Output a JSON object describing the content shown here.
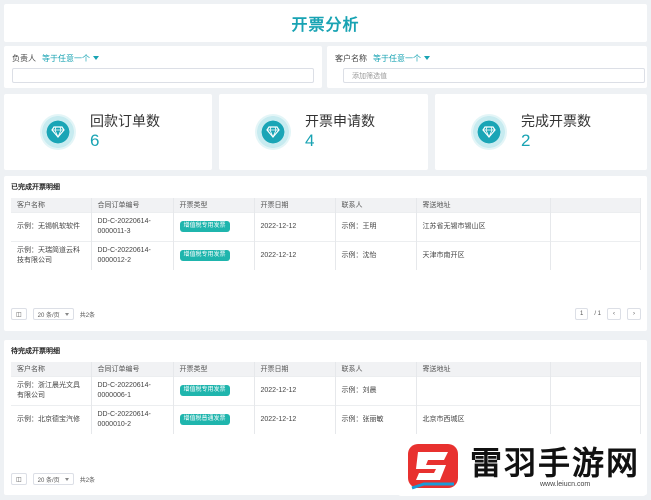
{
  "page": {
    "title": "开票分析"
  },
  "filters": [
    {
      "label": "负责人",
      "op": "等于任意一个",
      "placeholder": ""
    },
    {
      "label": "客户名称",
      "op": "等于任意一个",
      "placeholder": "添加筛选值"
    }
  ],
  "kpis": [
    {
      "label": "回款订单数",
      "value": "6",
      "icon": "diamond-icon"
    },
    {
      "label": "开票申请数",
      "value": "4",
      "icon": "diamond-icon"
    },
    {
      "label": "完成开票数",
      "value": "2",
      "icon": "diamond-icon"
    }
  ],
  "completed": {
    "title": "已完成开票明细",
    "columns": [
      "客户名称",
      "合同订单编号",
      "开票类型",
      "开票日期",
      "联系人",
      "寄送地址"
    ],
    "rows": [
      {
        "customer": "示例：无锡帆软软件",
        "order": "DD-C-20220614-0000011-3",
        "type": "增值税专用发票",
        "date": "2022-12-12",
        "contact": "示例：王明",
        "address": "江苏省无锡市锡山区"
      },
      {
        "customer": "示例：天瑞简道云科技有限公司",
        "order": "DD-C-20220614-0000012-2",
        "type": "增值税专用发票",
        "date": "2022-12-12",
        "contact": "示例：沈怡",
        "address": "天津市南开区"
      }
    ],
    "pager": {
      "page_size": "20 条/页",
      "total": "共2条",
      "page": "1",
      "of": "/ 1"
    }
  },
  "pending": {
    "title": "待完成开票明细",
    "columns": [
      "客户名称",
      "合同订单编号",
      "开票类型",
      "开票日期",
      "联系人",
      "寄送地址"
    ],
    "rows": [
      {
        "customer": "示例：浙江晨光文具有限公司",
        "order": "DD-C-20220614-0000006-1",
        "type": "增值税专用发票",
        "date": "2022-12-12",
        "contact": "示例：刘晨",
        "address": ""
      },
      {
        "customer": "示例：北京德宝汽修",
        "order": "DD-C-20220614-0000010-2",
        "type": "增值税普通发票",
        "date": "2022-12-12",
        "contact": "示例：张丽敏",
        "address": "北京市西城区"
      }
    ],
    "pager": {
      "page_size": "20 条/页",
      "total": "共2条"
    }
  },
  "watermark": {
    "name": "雷羽手游网",
    "url": "www.leiucn.com"
  },
  "colors": {
    "accent": "#18a3b3",
    "tag": "#1fb5ad",
    "background": "#eef1f4"
  }
}
